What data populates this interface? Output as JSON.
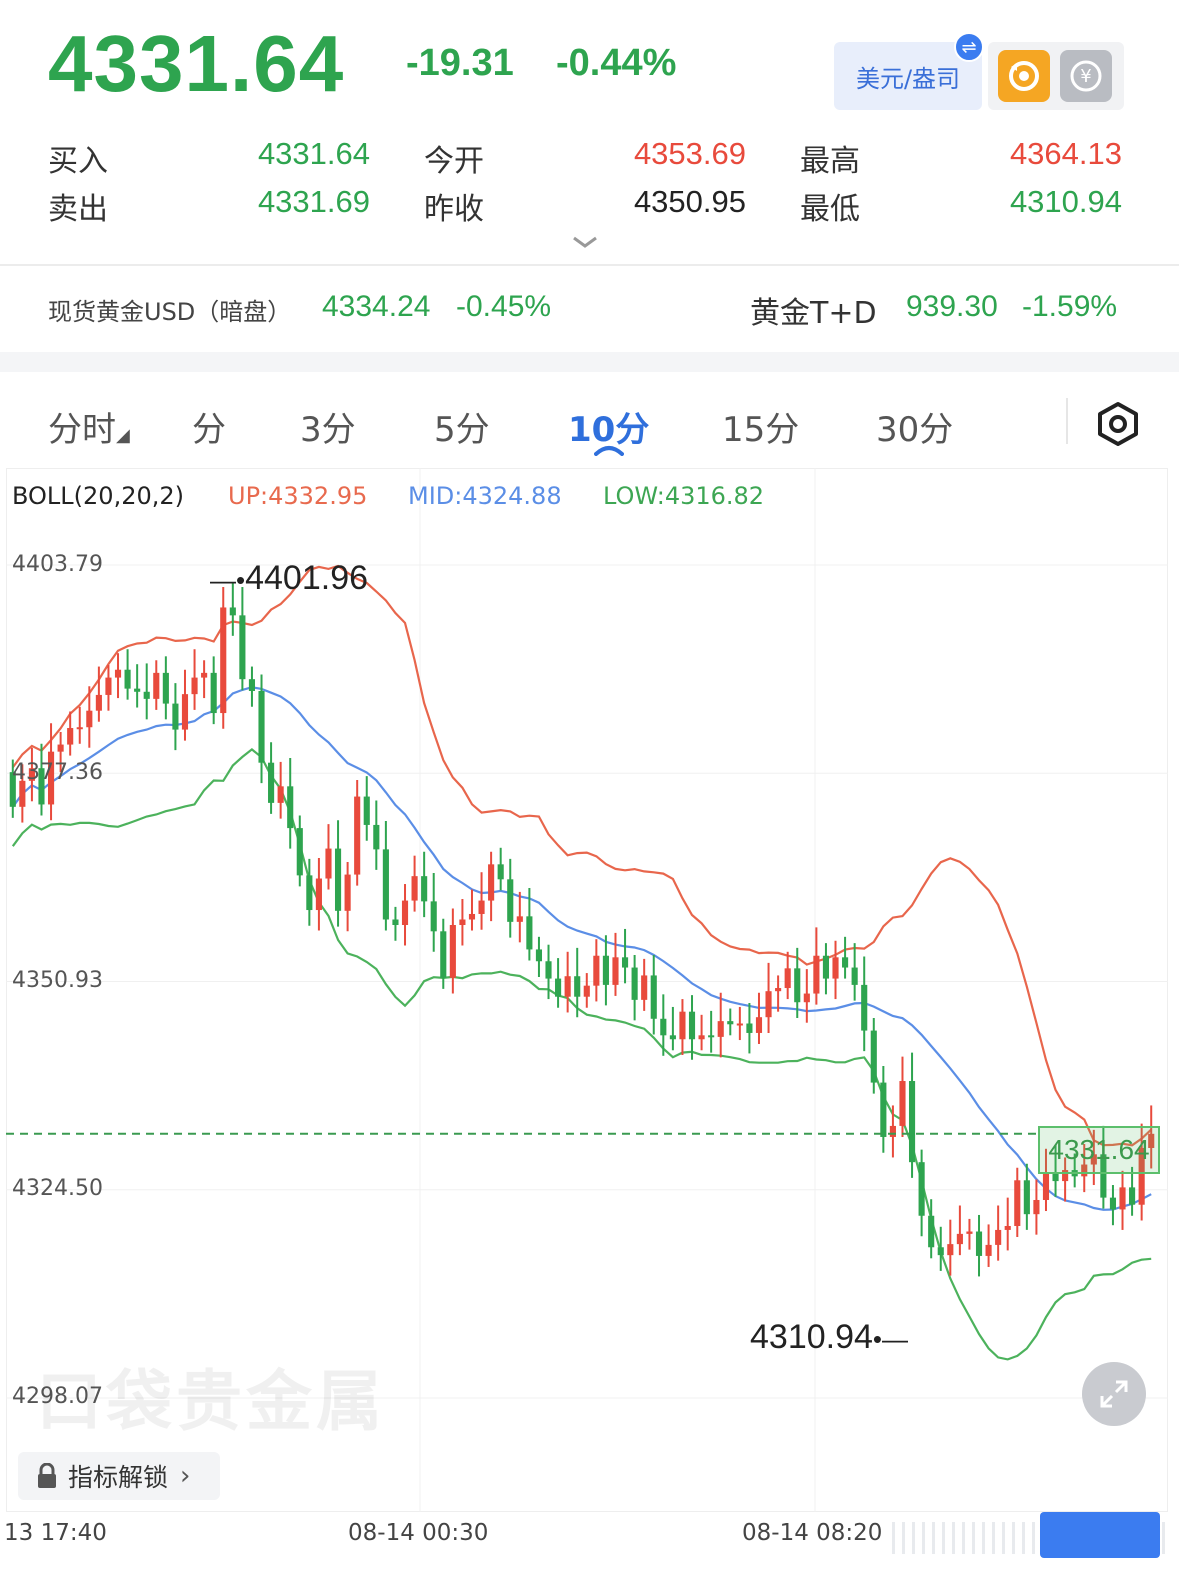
{
  "quote": {
    "last_price": "4331.64",
    "change": "-19.31",
    "change_pct": "-0.44%",
    "currency_button": "美元/盎司",
    "bid_label": "买入",
    "bid": "4331.64",
    "ask_label": "卖出",
    "ask": "4331.69",
    "open_label": "今开",
    "open": "4353.69",
    "prev_close_label": "昨收",
    "prev_close": "4350.95",
    "high_label": "最高",
    "high": "4364.13",
    "low_label": "最低",
    "low": "4310.94"
  },
  "related": {
    "spot_label": "现货黄金USD（暗盘）",
    "spot_price": "4334.24",
    "spot_pct": "-0.45%",
    "td_label": "黄金T+D",
    "td_price": "939.30",
    "td_pct": "-1.59%"
  },
  "tabs": [
    "分时",
    "分",
    "3分",
    "5分",
    "10分",
    "15分",
    "30分"
  ],
  "active_tab": "10分",
  "indicator": {
    "name": "BOLL(20,20,2)",
    "up": "UP:4332.95",
    "mid": "MID:4324.88",
    "low": "LOW:4316.82"
  },
  "lock_button": "指标解锁",
  "watermark": "口袋贵金属",
  "colors": {
    "up": "#e84a3c",
    "down": "#2ea44f",
    "mid_line": "#5b8ee6",
    "accent": "#2f6fdc"
  },
  "chart_data": {
    "type": "candlestick",
    "y_ticks": [
      "4403.79",
      "4377.36",
      "4350.93",
      "4324.50",
      "4298.07"
    ],
    "x_ticks": [
      "13 17:40",
      "08-14 00:30",
      "08-14 08:20"
    ],
    "max_label": "4401.96",
    "min_label": "4310.94",
    "current_price_tag": "4331.64",
    "ylim": [
      4298.07,
      4403.79
    ],
    "candles_count": 120,
    "open": [
      4377.5,
      4373.1,
      4376.4,
      4378.0,
      4373.4,
      4380.1,
      4381.0,
      4383.1,
      4383.2,
      4385.3,
      4387.3,
      4389.5,
      4390.5,
      4388.1,
      4387.7,
      4386.8,
      4390.1,
      4386.2,
      4382.9,
      4387.4,
      4389.5,
      4390.1,
      4385.0,
      4398.4,
      4397.4,
      4389.3,
      4387.8,
      4378.7,
      4373.6,
      4375.7,
      4370.4,
      4364.4,
      4360.0,
      4364.0,
      4367.8,
      4359.9,
      4364.5,
      4374.4,
      4370.8,
      4367.7,
      4358.8,
      4358.1,
      4361.2,
      4364.3,
      4361.1,
      4357.3,
      4351.4,
      4358.1,
      4358.8,
      4359.5,
      4361.2,
      4365.8,
      4363.9,
      4358.5,
      4359.2,
      4355.0,
      4353.5,
      4351.3,
      4349.0,
      4351.6,
      4349.0,
      4350.4,
      4354.2,
      4350.5,
      4354.0,
      4352.7,
      4348.6,
      4351.7,
      4346.2,
      4344.1,
      4343.6,
      4347.1,
      4343.6,
      4344.1,
      4343.9,
      4345.9,
      4345.5,
      4345.6,
      4344.4,
      4346.4,
      4349.7,
      4350.1,
      4352.6,
      4348.3,
      4349.4,
      4354.2,
      4351.3,
      4354.0,
      4352.7,
      4350.5,
      4344.7,
      4338.1,
      4331.2,
      4332.6,
      4338.3,
      4328.0,
      4321.2,
      4317.2,
      4316.2,
      4317.6,
      4318.9,
      4319.2,
      4316.1,
      4317.5,
      4319.4,
      4319.9,
      4325.7,
      4321.4,
      4323.2,
      4326.6,
      4325.6,
      4327.0,
      4326.2,
      4327.7,
      4329.0,
      4323.5,
      4322.0,
      4324.8,
      4322.6,
      4329.8
    ],
    "close": [
      4373.1,
      4376.4,
      4378.0,
      4373.4,
      4380.1,
      4381.0,
      4383.1,
      4383.2,
      4385.3,
      4387.3,
      4389.5,
      4390.5,
      4388.1,
      4387.7,
      4386.8,
      4390.1,
      4386.2,
      4382.9,
      4387.4,
      4389.5,
      4390.1,
      4385.0,
      4398.4,
      4397.4,
      4389.3,
      4387.8,
      4378.7,
      4373.6,
      4375.7,
      4370.4,
      4364.4,
      4360.0,
      4364.0,
      4367.8,
      4359.9,
      4364.5,
      4374.4,
      4370.8,
      4367.7,
      4358.8,
      4358.1,
      4361.2,
      4364.3,
      4361.1,
      4357.3,
      4351.4,
      4358.1,
      4358.8,
      4359.5,
      4361.2,
      4365.8,
      4363.9,
      4358.5,
      4359.2,
      4355.0,
      4353.5,
      4351.3,
      4349.0,
      4351.6,
      4349.0,
      4350.4,
      4354.2,
      4350.5,
      4354.0,
      4352.7,
      4348.6,
      4351.7,
      4346.2,
      4344.1,
      4343.6,
      4347.1,
      4343.6,
      4344.1,
      4343.9,
      4345.9,
      4345.5,
      4345.6,
      4344.4,
      4346.4,
      4349.7,
      4350.1,
      4352.6,
      4348.3,
      4349.4,
      4354.2,
      4351.3,
      4354.0,
      4352.7,
      4350.5,
      4344.7,
      4338.1,
      4331.2,
      4332.6,
      4338.3,
      4328.0,
      4321.2,
      4317.2,
      4316.2,
      4317.6,
      4318.9,
      4319.2,
      4316.1,
      4317.5,
      4319.4,
      4319.9,
      4325.7,
      4321.4,
      4323.2,
      4326.6,
      4325.6,
      4327.0,
      4326.2,
      4327.7,
      4329.0,
      4323.5,
      4322.0,
      4324.8,
      4322.6,
      4329.8,
      4331.6
    ]
  }
}
